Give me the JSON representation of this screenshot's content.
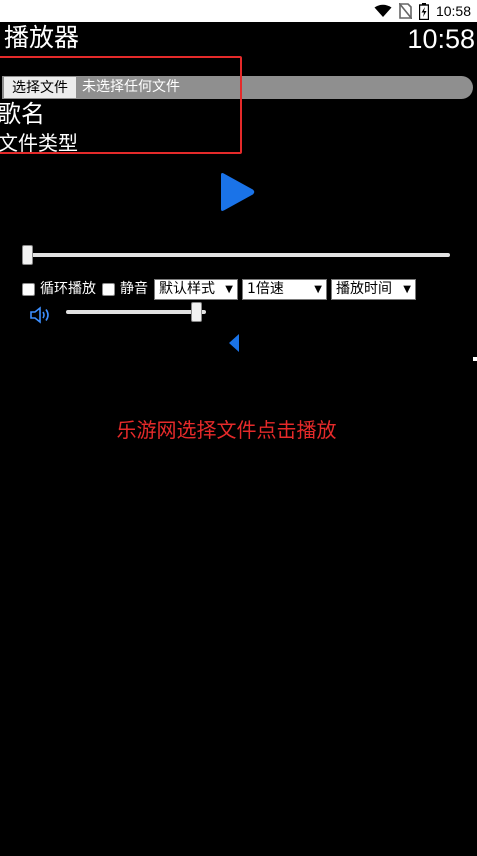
{
  "status_bar": {
    "time": "10:58",
    "icons": [
      "wifi-icon",
      "no-sim-icon",
      "battery-charging-icon"
    ]
  },
  "header": {
    "title": "播放器",
    "clock": "10:58"
  },
  "file_input": {
    "button_label": "选择文件",
    "status_text": "未选择任何文件"
  },
  "track": {
    "song_name": "歌名",
    "file_type": "文件类型"
  },
  "progress": {
    "value": 0
  },
  "controls": {
    "loop_label": "循环播放",
    "mute_label": "静音",
    "style_select": "默认样式",
    "speed_select": "1倍速",
    "time_select": "播放时间"
  },
  "volume": {
    "value": 0.97
  },
  "hint": "乐游网选择文件点击播放",
  "colors": {
    "accent": "#1a73e8",
    "highlight": "#e52a2a",
    "background": "#000000"
  }
}
